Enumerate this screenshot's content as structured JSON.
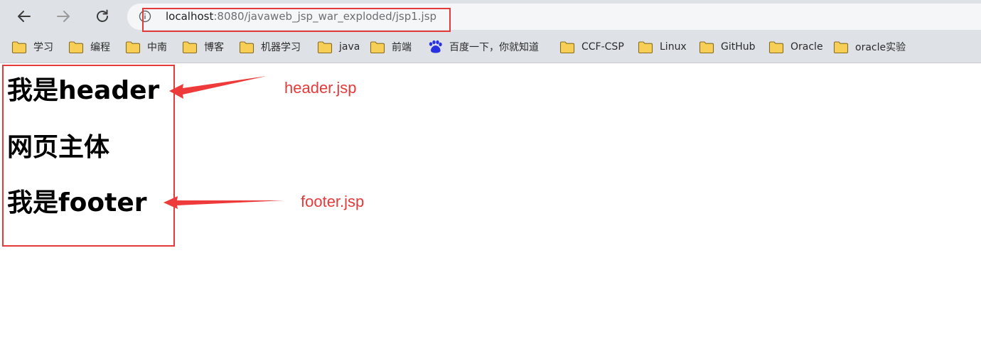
{
  "browser": {
    "url_host": "localhost",
    "url_path": ":8080/javaweb_jsp_war_exploded/jsp1.jsp",
    "bookmarks": [
      {
        "label": "学习",
        "icon": "folder-icon"
      },
      {
        "label": "编程",
        "icon": "folder-icon"
      },
      {
        "label": "中南",
        "icon": "folder-icon"
      },
      {
        "label": "博客",
        "icon": "folder-icon"
      },
      {
        "label": "机器学习",
        "icon": "folder-icon"
      },
      {
        "label": "java",
        "icon": "folder-icon"
      },
      {
        "label": "前端",
        "icon": "folder-icon"
      },
      {
        "label": "百度一下，你就知道",
        "icon": "baidu-paw-icon"
      },
      {
        "label": "CCF-CSP",
        "icon": "folder-icon"
      },
      {
        "label": "Linux",
        "icon": "folder-icon"
      },
      {
        "label": "GitHub",
        "icon": "folder-icon"
      },
      {
        "label": "Oracle",
        "icon": "folder-icon"
      },
      {
        "label": "oracle实验",
        "icon": "folder-icon"
      }
    ]
  },
  "page": {
    "header_text": "我是header",
    "body_text": "网页主体",
    "footer_text": "我是footer"
  },
  "annotations": {
    "header_label": "header.jsp",
    "footer_label": "footer.jsp",
    "color": "#e53a3a"
  },
  "colors": {
    "toolbar_bg": "#dee1e6",
    "folder_fill": "#f7cf57",
    "highlight": "#e53a3a"
  }
}
